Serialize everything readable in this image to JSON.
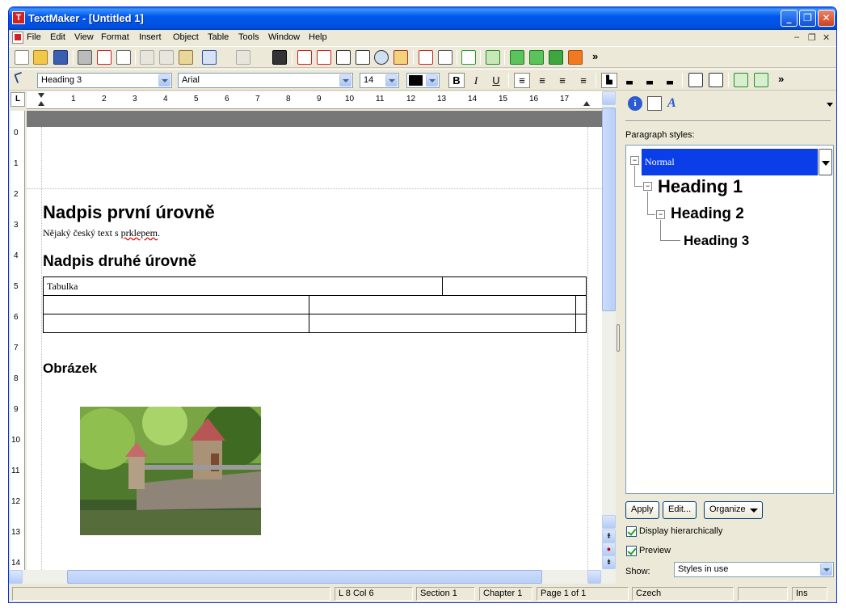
{
  "window": {
    "title": "TextMaker - [Untitled 1]",
    "app_icon_letter": "T"
  },
  "title_buttons": {
    "minimize": "_",
    "restore": "❐",
    "close": "✕"
  },
  "menu": {
    "items": [
      "File",
      "Edit",
      "View",
      "Format",
      "Insert",
      "Object",
      "Table",
      "Tools",
      "Window",
      "Help"
    ],
    "mdi": {
      "minimize": "–",
      "restore": "❐",
      "close": "✕"
    }
  },
  "toolbar": {
    "more": "»",
    "icons": [
      "new-document-icon",
      "open-folder-icon",
      "save-icon",
      "print-icon",
      "pdf-export-icon",
      "print-preview-icon",
      "cut-icon",
      "copy-icon",
      "paste-icon",
      "undo-icon",
      "redo-icon",
      "find-icon",
      "insert-field-icon",
      "insert-frame-icon",
      "insert-textframe-icon",
      "columns-icon",
      "zoom-icon",
      "replace-icon",
      "font-icon",
      "format-icon",
      "spellcheck-icon",
      "track-changes-icon",
      "show-paragraph-icon",
      "hyphenation-icon",
      "preview-p-icon",
      "styles-s-icon"
    ]
  },
  "format_bar": {
    "style": "Heading 3",
    "font": "Arial",
    "size": "14",
    "bold": "B",
    "italic": "I",
    "underline": "U",
    "more": "»"
  },
  "ruler": {
    "corner": "L",
    "h_numbers": [
      "1",
      "2",
      "3",
      "4",
      "5",
      "6",
      "7",
      "8",
      "9",
      "10",
      "11",
      "12",
      "13",
      "14",
      "15",
      "16",
      "17"
    ],
    "v_numbers": [
      "0",
      "1",
      "2",
      "3",
      "4",
      "5",
      "6",
      "7",
      "8",
      "9",
      "10",
      "11",
      "12",
      "13",
      "14"
    ]
  },
  "document": {
    "heading1": "Nadpis první úrovně",
    "body_before": "Nějaký český text s ",
    "body_misspelled": "prklepem",
    "body_after": ".",
    "heading2": "Nadpis druhé úrovně",
    "table": {
      "row1": [
        "Tabulka",
        ""
      ],
      "rows": [
        [
          "",
          "",
          ""
        ],
        [
          "",
          "",
          ""
        ]
      ]
    },
    "heading3": "Obrázek"
  },
  "panel": {
    "styles_label": "Paragraph styles:",
    "tree": [
      {
        "label": "Normal"
      },
      {
        "label": "Heading 1"
      },
      {
        "label": "Heading 2"
      },
      {
        "label": "Heading 3"
      }
    ],
    "tree_collapse_glyph": "−",
    "buttons": {
      "apply": "Apply",
      "edit": "Edit...",
      "organize": "Organize"
    },
    "display_hierarchically": "Display hierarchically",
    "preview": "Preview",
    "show_label": "Show:",
    "show_value": "Styles in use"
  },
  "status": {
    "position": "L 8 Col 6",
    "section": "Section 1",
    "chapter": "Chapter 1",
    "page": "Page 1 of 1",
    "language": "Czech",
    "mode": "Ins"
  }
}
